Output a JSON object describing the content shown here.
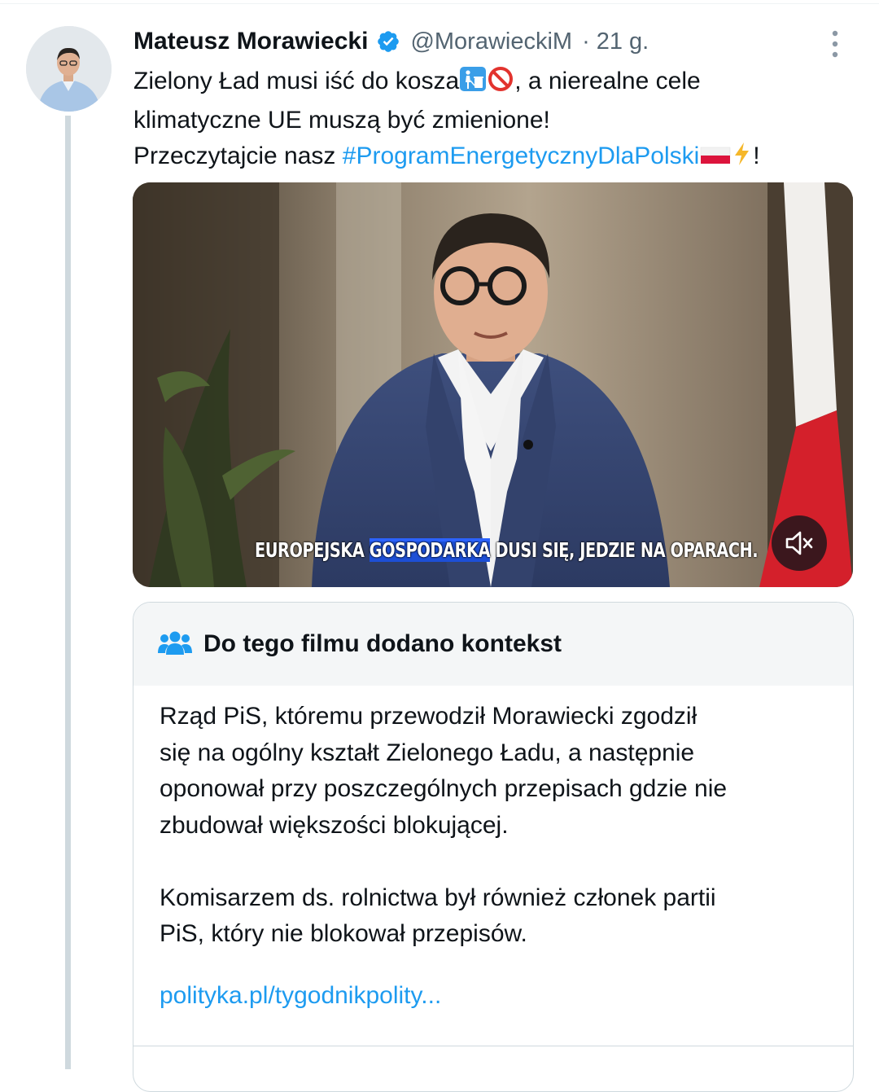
{
  "tweet": {
    "author_name": "Mateusz Morawiecki",
    "handle": "@MorawieckiM",
    "separator": "·",
    "time": "21 g.",
    "text_lines": [
      "Zielony Ład musi iść do kosza",
      ", a nierealne cele",
      "klimatyczne UE muszą być zmienione!",
      "Przeczytajcie nasz ",
      "#ProgramEnergetycznyDlaPolski",
      "!"
    ],
    "icons": [
      "verified-badge-icon",
      "more-options-icon",
      "trash-emoji-icon",
      "no-entry-emoji-icon",
      "poland-flag-emoji-icon",
      "lightning-emoji-icon"
    ]
  },
  "video": {
    "subtitle_before": "EUROPEJSKA ",
    "subtitle_highlight": "GOSPODARKA",
    "subtitle_after": " DUSI SIĘ, JEDZIE NA OPARACH.",
    "mute_icon": "muted-speaker-icon"
  },
  "community_note": {
    "title": "Do tego filmu dodano kontekst",
    "icon": "people-icon",
    "paragraph1": [
      "Rząd PiS, któremu przewodził Morawiecki zgodził",
      "się na ogólny kształt Zielonego Ładu,  a następnie",
      "oponował przy poszczególnych przepisach gdzie nie",
      "zbudował większości blokującej."
    ],
    "paragraph2": [
      "Komisarzem ds. rolnictwa był również członek partii",
      "PiS, który nie blokował przepisów."
    ],
    "link": "polityka.pl/tygodnikpolity..."
  },
  "colors": {
    "accent": "#1d9bf0",
    "text": "#0f1419",
    "secondary": "#536471",
    "border": "#cfd9de",
    "note_header_bg": "#f4f6f7"
  }
}
